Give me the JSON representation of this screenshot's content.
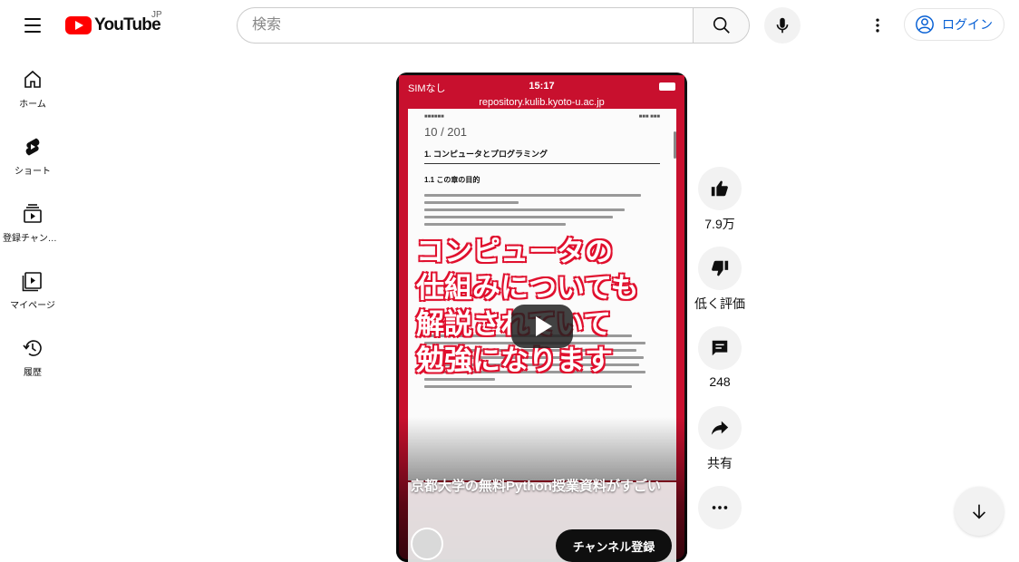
{
  "header": {
    "logo_text": "YouTube",
    "logo_region": "JP",
    "search_placeholder": "検索",
    "login_label": "ログイン"
  },
  "sidebar": {
    "items": [
      {
        "label": "ホーム",
        "icon": "home-icon"
      },
      {
        "label": "ショート",
        "icon": "shorts-icon"
      },
      {
        "label": "登録チャンネル",
        "icon": "subscriptions-icon"
      },
      {
        "label": "マイページ",
        "icon": "you-icon"
      },
      {
        "label": "履歴",
        "icon": "history-icon"
      }
    ]
  },
  "player": {
    "status_carrier": "SIMなし",
    "status_time": "15:17",
    "url": "repository.kulib.kyoto-u.ac.jp",
    "page_counter": "10 / 201",
    "doc_heading": "1. コンピュータとプログラミング",
    "doc_subheading": "1.1 この章の目的",
    "overlay_text": "コンピュータの\n仕組みについても\n解説されていて\n勉強になります",
    "video_title": "京都大学の無料Python授業資料がすごい",
    "subscribe_label": "チャンネル登録"
  },
  "actions": {
    "like_count": "7.9万",
    "dislike_label": "低く評価",
    "comment_count": "248",
    "share_label": "共有"
  },
  "colors": {
    "brand_red": "#ff0000",
    "link_blue": "#065fd4",
    "overlay_stroke": "#e0102e"
  }
}
